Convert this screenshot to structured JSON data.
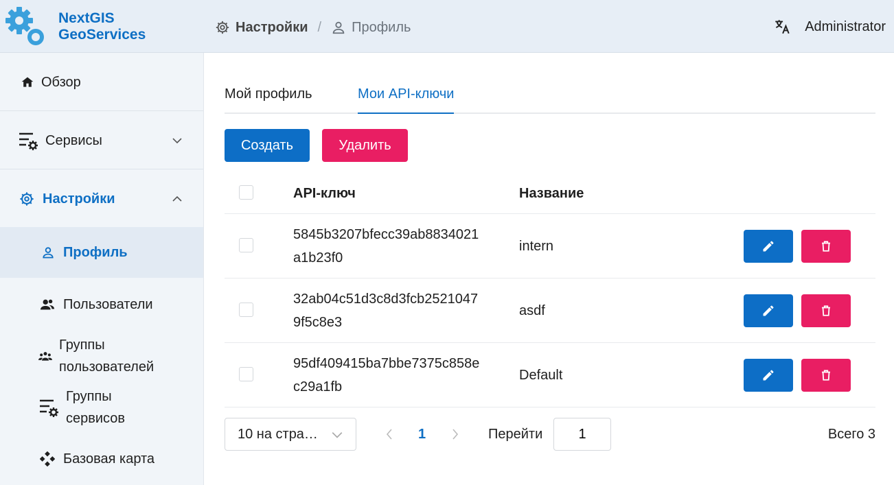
{
  "app": {
    "brand_line1": "NextGIS",
    "brand_line2": "GeoServices",
    "accent": "#0e6fc4",
    "danger": "#e91e63"
  },
  "header": {
    "breadcrumb_current": "Настройки",
    "breadcrumb_separator": "/",
    "breadcrumb_last": "Профиль",
    "user": "Administrator",
    "lang_icon": "translate-icon"
  },
  "sidebar": {
    "items": [
      {
        "label": "Обзор",
        "icon": "home-icon"
      },
      {
        "label": "Сервисы",
        "icon": "services-icon"
      },
      {
        "label": "Настройки",
        "icon": "gear-icon"
      },
      {
        "label": "Профиль",
        "icon": "user-icon"
      },
      {
        "label": "Пользователи",
        "icon": "users-icon"
      },
      {
        "label_line1": "Группы",
        "label_line2": "пользователей",
        "icon": "user-groups-icon"
      },
      {
        "label_line1": "Группы",
        "label_line2": "сервисов",
        "icon": "service-groups-icon"
      },
      {
        "label": "Базовая карта",
        "icon": "basemap-icon"
      }
    ]
  },
  "tabs": [
    {
      "label": "Мой профиль"
    },
    {
      "label": "Мои API-ключи"
    }
  ],
  "toolbar": {
    "create_label": "Создать",
    "delete_label": "Удалить"
  },
  "table": {
    "headers": {
      "key": "API-ключ",
      "name": "Название"
    },
    "rows": [
      {
        "key_line1": "5845b3207bfecc39ab8834021",
        "key_line2": "a1b23f0",
        "name": "intern"
      },
      {
        "key_line1": "32ab04c51d3c8d3fcb2521047",
        "key_line2": "9f5c8e3",
        "name": "asdf"
      },
      {
        "key_line1": "95df409415ba7bbe7375c858e",
        "key_line2": "c29a1fb",
        "name": "Default"
      }
    ]
  },
  "pagination": {
    "page_size": "10 на стра…",
    "current_page": "1",
    "goto_label": "Перейти",
    "goto_value": "1",
    "total": "Всего 3"
  }
}
